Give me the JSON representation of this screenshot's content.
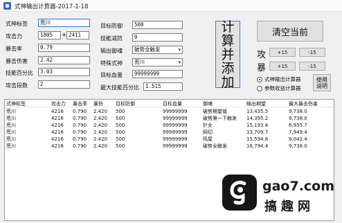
{
  "window": {
    "title": "式神输出计算器-2017-1-18"
  },
  "form": {
    "name_label": "式神标签",
    "name_value": "荒川",
    "atk_label": "攻击力",
    "atk_base": "1805",
    "plus": "+",
    "atk_bonus": "2411",
    "crit_label": "暴击率",
    "crit_value": "0.79",
    "critdmg_label": "暴击伤害",
    "critdmg_value": "2.42",
    "skill_label": "技能百分比",
    "skill_value": "3.03",
    "hits_label": "攻击段数",
    "hits_value": "2",
    "def_label": "目标防御",
    "def_value": "500",
    "reduce_label": "技能减防",
    "reduce_value": "0",
    "yuhun_label": "输出御魂",
    "yuhun_value": "破势全触发",
    "special_label": "特殊式神",
    "special_value": "荒川",
    "hp_label": "目标血量",
    "hp_value": "99999999",
    "maxskill_label": "最大技能百分比",
    "maxskill_value": "1.515"
  },
  "buttons": {
    "calc": [
      "计",
      "算",
      "并",
      "添",
      "加"
    ],
    "clear": "清空当前",
    "plus15": "+15",
    "minus15": "-15",
    "help": [
      "使用",
      "说明"
    ]
  },
  "adjust": {
    "label_top": "攻",
    "label_bottom": "暴"
  },
  "mode": {
    "options": [
      "式神输出计算器",
      "参数收益计算器"
    ],
    "selected": "式神输出计算器"
  },
  "table": {
    "columns": [
      "式神标签",
      "攻击力",
      "暴击率",
      "暴伤",
      "目标防御",
      "目标血量",
      "御魂",
      "输出期望",
      "最大暴击伤害"
    ],
    "rows": [
      [
        "荒川",
        "4216",
        "0.790",
        "2.420",
        "500",
        "99999999",
        "破势期望值",
        "13,435.5",
        "9,738.0"
      ],
      [
        "荒川",
        "4216",
        "0.790",
        "2.420",
        "500",
        "99999999",
        "破势第一下触发",
        "14,395.2",
        "9,738.0"
      ],
      [
        "荒川",
        "4216",
        "0.790",
        "2.420",
        "500",
        "99999999",
        "针女",
        "15,193.4",
        "6,955.7"
      ],
      [
        "荒川",
        "4216",
        "0.790",
        "2.420",
        "500",
        "99999999",
        "网切",
        "13,709.7",
        "7,949.4"
      ],
      [
        "荒川",
        "4216",
        "0.790",
        "2.420",
        "500",
        "99999999",
        "鸣屋",
        "15,594.8",
        "9,042.4"
      ],
      [
        "荒川",
        "4216",
        "0.790",
        "2.420",
        "500",
        "99999999",
        "破势全触发",
        "16,794.4",
        "9,738.0"
      ]
    ]
  },
  "watermark": {
    "site": "gao7.com",
    "brand": "搞趣网"
  },
  "colors": {
    "focus_border": "#2b6fd6",
    "calc_border": "#4a78c8",
    "titlebar": "#fbfbfb"
  }
}
